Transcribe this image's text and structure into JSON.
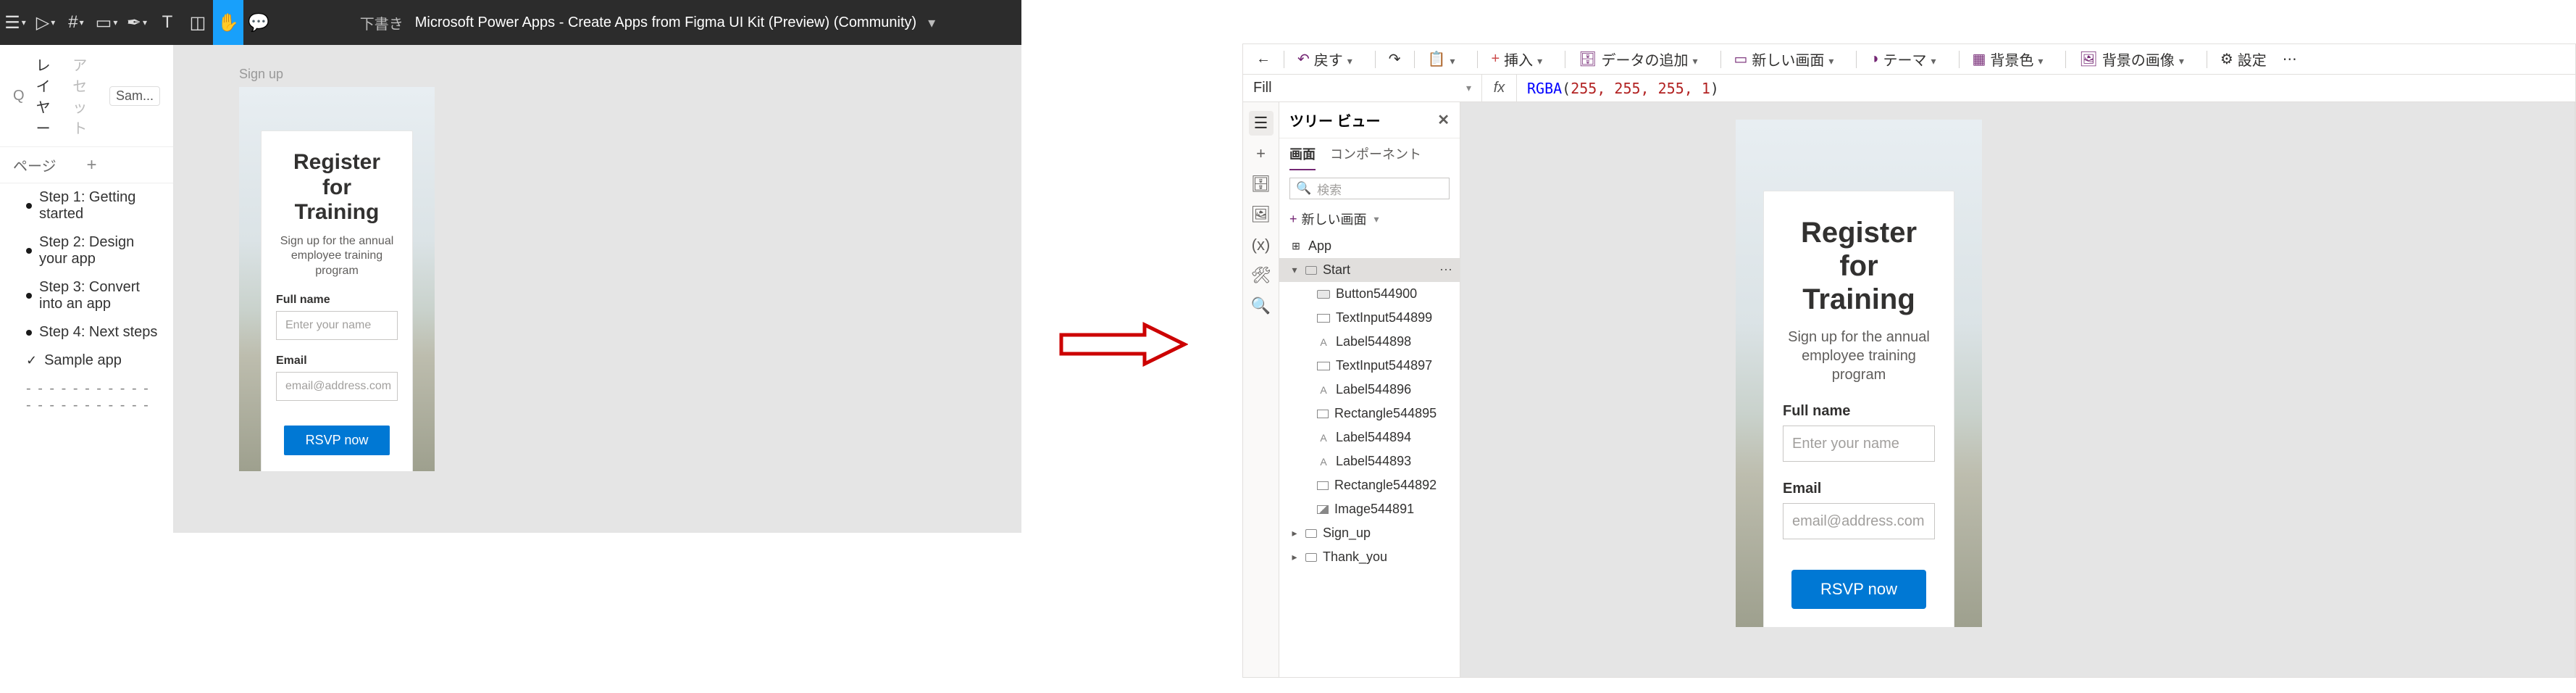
{
  "figma": {
    "toolbar": {
      "draft_label": "下書き",
      "title": "Microsoft Power Apps - Create Apps from Figma UI Kit (Preview) (Community)"
    },
    "panel": {
      "tab_layers": "レイヤー",
      "tab_assets": "アセット",
      "select": "Sam...",
      "pages_header": "ページ",
      "pages": [
        "Step 1: Getting started",
        "Step 2: Design your app",
        "Step 3: Convert into an app",
        "Step 4: Next steps"
      ],
      "sample": "Sample app",
      "dashes": "- - - - - - - - - - - - - - - - - - - - - -"
    },
    "frame_label": "Sign up"
  },
  "powerapps": {
    "ribbon": {
      "undo": "戻す",
      "insert": "挿入",
      "add_data": "データの追加",
      "new_screen": "新しい画面",
      "theme": "テーマ",
      "bgcolor": "背景色",
      "bgimage": "背景の画像",
      "settings": "設定"
    },
    "formula": {
      "prop": "Fill",
      "fx": "fx",
      "fn": "RGBA",
      "args": "255, 255, 255, 1"
    },
    "tree": {
      "title": "ツリー ビュー",
      "tab_screens": "画面",
      "tab_components": "コンポーネント",
      "search": "検索",
      "new_screen": "新しい画面",
      "app": "App",
      "start": "Start",
      "children": [
        {
          "icon": "btn",
          "label": "Button544900"
        },
        {
          "icon": "input",
          "label": "TextInput544899"
        },
        {
          "icon": "label",
          "label": "Label544898"
        },
        {
          "icon": "input",
          "label": "TextInput544897"
        },
        {
          "icon": "label",
          "label": "Label544896"
        },
        {
          "icon": "rect",
          "label": "Rectangle544895"
        },
        {
          "icon": "label",
          "label": "Label544894"
        },
        {
          "icon": "label",
          "label": "Label544893"
        },
        {
          "icon": "rect",
          "label": "Rectangle544892"
        },
        {
          "icon": "img",
          "label": "Image544891"
        }
      ],
      "signup": "Sign_up",
      "thankyou": "Thank_you"
    }
  },
  "form": {
    "title1": "Register for",
    "title2": "Training",
    "sub1": "Sign up for the annual",
    "sub2": "employee training program",
    "fullname_label": "Full name",
    "fullname_ph": "Enter your name",
    "email_label": "Email",
    "email_ph": "email@address.com",
    "btn": "RSVP now"
  }
}
